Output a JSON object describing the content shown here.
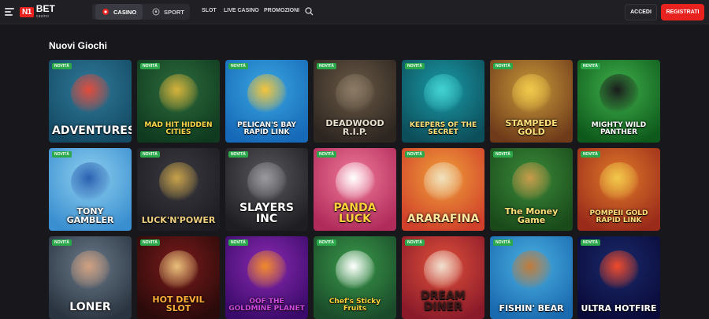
{
  "header": {
    "logo_mark": "N1",
    "logo_text": "BET",
    "logo_sub": "casino",
    "tabs": [
      {
        "label": "CASINO",
        "active": true
      },
      {
        "label": "SPORT",
        "active": false
      }
    ],
    "links": [
      "SLOT",
      "LIVE CASINO",
      "PROMOZIONI"
    ],
    "login_label": "ACCEDI",
    "register_label": "REGISTRATI"
  },
  "section": {
    "title": "Nuovi Giochi"
  },
  "badge_label": "NOVITÀ",
  "games": [
    {
      "title": "ADVENTURES",
      "colors": [
        "#2f7a9a",
        "#144a63"
      ],
      "accent": "#e24a3a",
      "title_color": "#ffffff"
    },
    {
      "title": "MAD HIT HIDDEN CITIES",
      "colors": [
        "#2d6b3c",
        "#0f3a1f"
      ],
      "accent": "#d7b23a",
      "title_color": "#ffd84a"
    },
    {
      "title": "PELICAN'S BAY RAPID LINK",
      "colors": [
        "#3aa6e0",
        "#1669b8"
      ],
      "accent": "#f3c33a",
      "title_color": "#ffffff"
    },
    {
      "title": "DEADWOOD R.I.P.",
      "colors": [
        "#6b5a46",
        "#2c2520"
      ],
      "accent": "#8a7a66",
      "title_color": "#e8e0d0"
    },
    {
      "title": "KEEPERS OF THE SECRET",
      "colors": [
        "#1a9aa6",
        "#0c4e5a"
      ],
      "accent": "#43d2d0",
      "title_color": "#ffe27a"
    },
    {
      "title": "STAMPEDE GOLD",
      "colors": [
        "#c99a3a",
        "#6e3a1a"
      ],
      "accent": "#f0c84a",
      "title_color": "#ffe07a"
    },
    {
      "title": "MIGHTY WILD PANTHER",
      "colors": [
        "#3fb04a",
        "#0e5a1c"
      ],
      "accent": "#1a1a1a",
      "title_color": "#ffffff"
    },
    {
      "title": "TONY GAMBLER",
      "colors": [
        "#8fd0f0",
        "#3a8fd0"
      ],
      "accent": "#2a5fb0",
      "title_color": "#ffffff"
    },
    {
      "title": "LUCK'N'POWER",
      "colors": [
        "#3a3a40",
        "#1c1c22"
      ],
      "accent": "#c8a24a",
      "title_color": "#f0d080"
    },
    {
      "title": "SLAYERS INC",
      "colors": [
        "#5a5a5e",
        "#1e1e22"
      ],
      "accent": "#9a9a9e",
      "title_color": "#ffffff"
    },
    {
      "title": "PANDA LUCK",
      "colors": [
        "#f07a9a",
        "#b02a5a"
      ],
      "accent": "#ffffff",
      "title_color": "#ffd23a"
    },
    {
      "title": "ARARAFINA",
      "colors": [
        "#f0a03a",
        "#d0402a"
      ],
      "accent": "#f0e0c0",
      "title_color": "#ffe8a0"
    },
    {
      "title": "The Money Game",
      "colors": [
        "#3a8a3a",
        "#1a4a1a"
      ],
      "accent": "#c89a4a",
      "title_color": "#ffe07a"
    },
    {
      "title": "POMPEII GOLD RAPID LINK",
      "colors": [
        "#e07a2a",
        "#9a2a1a"
      ],
      "accent": "#f0c84a",
      "title_color": "#ffe07a"
    },
    {
      "title": "LONER",
      "colors": [
        "#6a7a8a",
        "#2a3440"
      ],
      "accent": "#d0a080",
      "title_color": "#ffffff"
    },
    {
      "title": "HOT DEVIL SLOT",
      "colors": [
        "#7a1a1a",
        "#2a0a0a"
      ],
      "accent": "#e8c07a",
      "title_color": "#ffb03a"
    },
    {
      "title": "OOF THE GOLDMINE PLANET",
      "colors": [
        "#8a2ab0",
        "#3a0a6a"
      ],
      "accent": "#f08a2a",
      "title_color": "#d04ae0"
    },
    {
      "title": "Chef's Sticky Fruits",
      "colors": [
        "#3a9a4a",
        "#1a4a2a"
      ],
      "accent": "#ffffff",
      "title_color": "#ffd23a"
    },
    {
      "title": "DREAM DINER",
      "colors": [
        "#e0503a",
        "#8a1a2a"
      ],
      "accent": "#f0e0d0",
      "title_color": "#3a1a1a"
    },
    {
      "title": "FISHIN' BEAR",
      "colors": [
        "#4ab0e0",
        "#1a6ab0"
      ],
      "accent": "#c07a3a",
      "title_color": "#ffffff"
    },
    {
      "title": "ULTRA HOTFIRE",
      "colors": [
        "#1a2a6a",
        "#0a0a3a"
      ],
      "accent": "#f04a2a",
      "title_color": "#ffffff"
    }
  ]
}
